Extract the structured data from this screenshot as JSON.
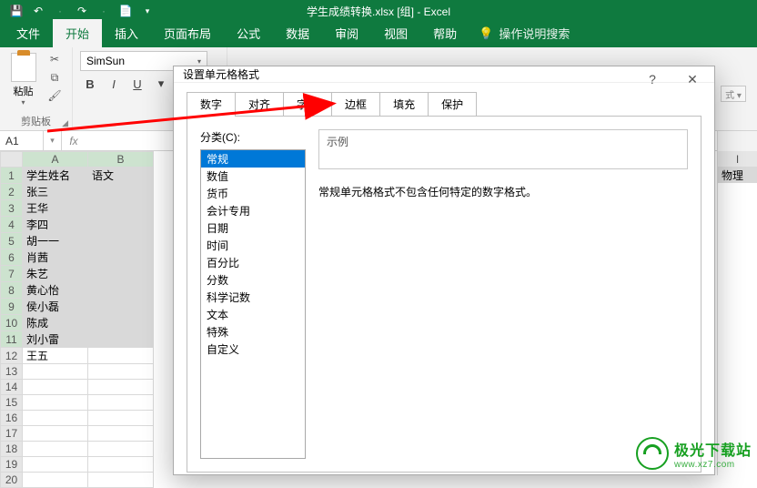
{
  "app": {
    "title": "学生成绩转换.xlsx  [组]  -  Excel"
  },
  "qat": {
    "save": "💾",
    "undo": "↶",
    "redo": "↷",
    "touch": "📄"
  },
  "tabs": {
    "file": "文件",
    "home": "开始",
    "insert": "插入",
    "layout": "页面布局",
    "formulas": "公式",
    "data": "数据",
    "review": "审阅",
    "view": "视图",
    "help": "帮助",
    "tellme": "操作说明搜索"
  },
  "ribbon": {
    "paste_label": "粘贴",
    "clipboard_label": "剪贴板",
    "font_name": "SimSun",
    "bold": "B",
    "italic": "I",
    "underline": "U"
  },
  "namebox": {
    "ref": "A1"
  },
  "right_edge": {
    "col": "I",
    "val": "物理"
  },
  "dialog": {
    "title": "设置单元格格式",
    "tabs": {
      "number": "数字",
      "align": "对齐",
      "font": "字体",
      "border": "边框",
      "fill": "填充",
      "protect": "保护"
    },
    "category_label": "分类(C):",
    "categories": [
      "常规",
      "数值",
      "货币",
      "会计专用",
      "日期",
      "时间",
      "百分比",
      "分数",
      "科学记数",
      "文本",
      "特殊",
      "自定义"
    ],
    "sample_label": "示例",
    "desc": "常规单元格格式不包含任何特定的数字格式。"
  },
  "styledrop": "式 ▾",
  "sheet": {
    "cols": [
      "A",
      "B"
    ],
    "rows": [
      {
        "n": "1",
        "a": "学生姓名",
        "b": "语文",
        "sel": true
      },
      {
        "n": "2",
        "a": "张三",
        "b": "",
        "sel": true
      },
      {
        "n": "3",
        "a": "王华",
        "b": "",
        "sel": true
      },
      {
        "n": "4",
        "a": "李四",
        "b": "",
        "sel": true
      },
      {
        "n": "5",
        "a": "胡一一",
        "b": "",
        "sel": true
      },
      {
        "n": "6",
        "a": "肖茜",
        "b": "",
        "sel": true
      },
      {
        "n": "7",
        "a": "朱艺",
        "b": "",
        "sel": true
      },
      {
        "n": "8",
        "a": "黄心怡",
        "b": "",
        "sel": true
      },
      {
        "n": "9",
        "a": "侯小磊",
        "b": "",
        "sel": true
      },
      {
        "n": "10",
        "a": "陈成",
        "b": "",
        "sel": true
      },
      {
        "n": "11",
        "a": "刘小雷",
        "b": "",
        "sel": true
      },
      {
        "n": "12",
        "a": "王五",
        "b": "",
        "sel": false
      },
      {
        "n": "13",
        "a": "",
        "b": "",
        "sel": false
      },
      {
        "n": "14",
        "a": "",
        "b": "",
        "sel": false
      },
      {
        "n": "15",
        "a": "",
        "b": "",
        "sel": false
      },
      {
        "n": "16",
        "a": "",
        "b": "",
        "sel": false
      },
      {
        "n": "17",
        "a": "",
        "b": "",
        "sel": false
      },
      {
        "n": "18",
        "a": "",
        "b": "",
        "sel": false
      },
      {
        "n": "19",
        "a": "",
        "b": "",
        "sel": false
      },
      {
        "n": "20",
        "a": "",
        "b": "",
        "sel": false
      }
    ]
  },
  "watermark": {
    "brand": "极光下载站",
    "url": "www.xz7.com"
  }
}
